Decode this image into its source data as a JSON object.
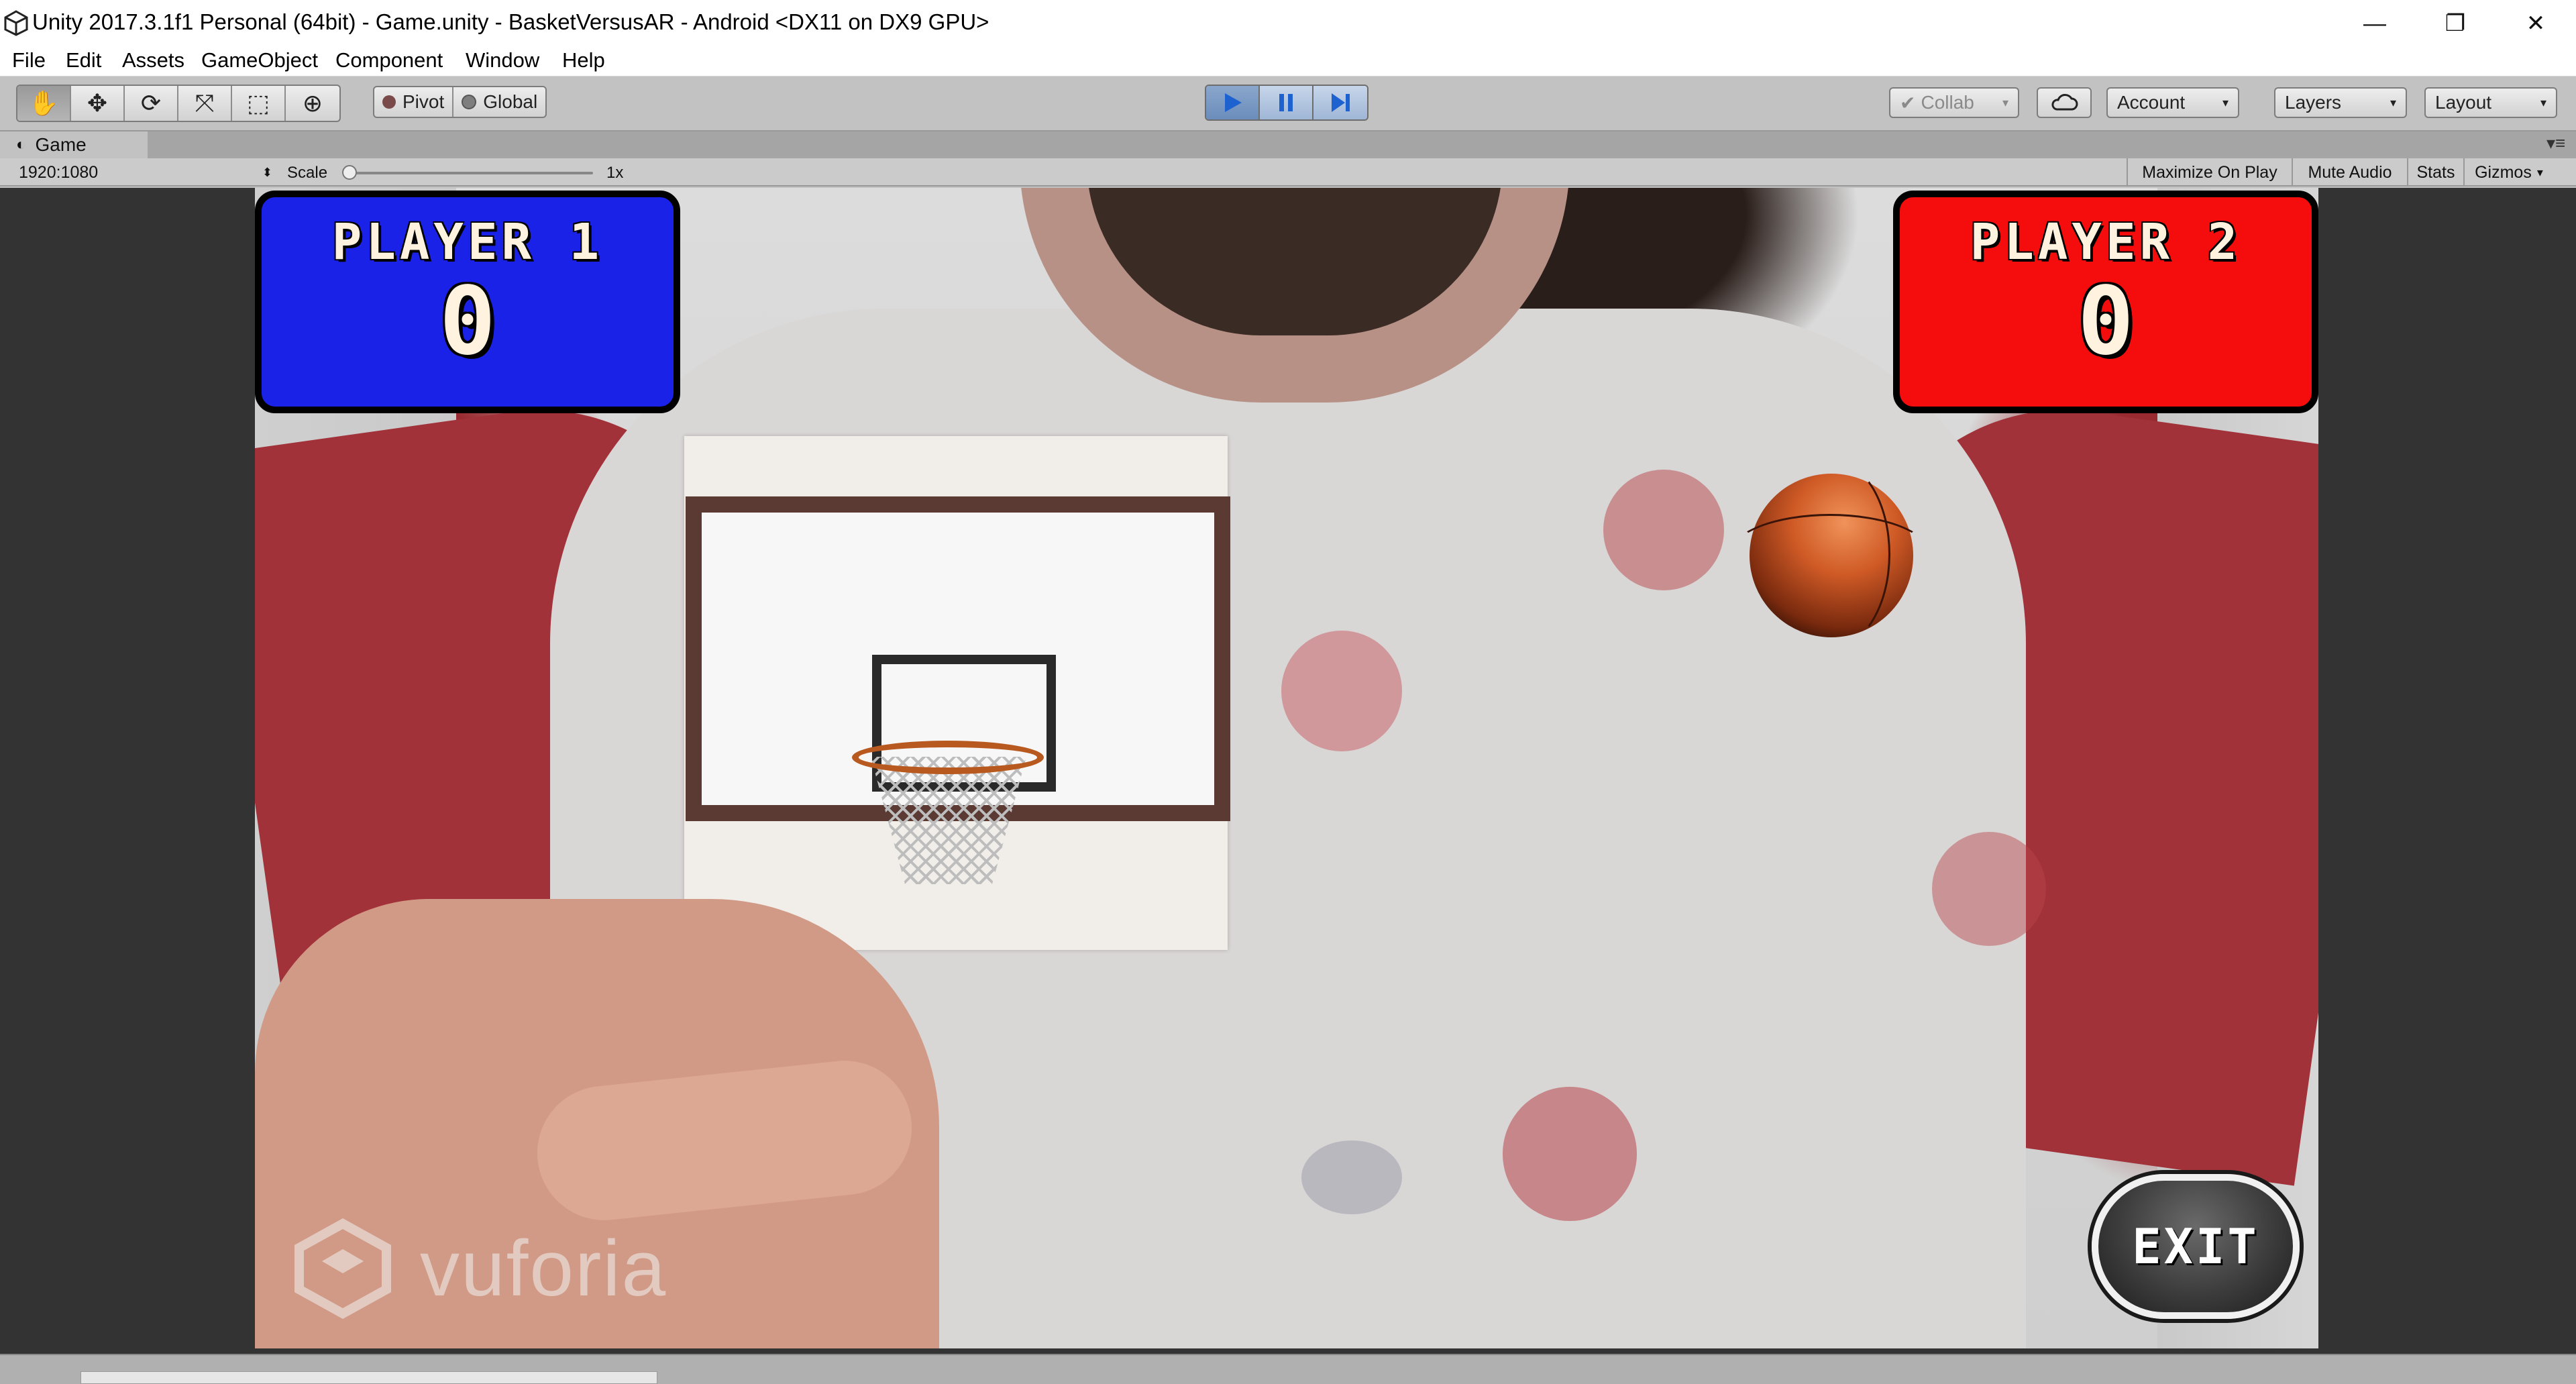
{
  "window": {
    "title": "Unity 2017.3.1f1 Personal (64bit) - Game.unity - BasketVersusAR - Android <DX11 on DX9 GPU>",
    "app_icon": "unity-icon",
    "minimize": "—",
    "maximize": "❐",
    "close": "✕"
  },
  "menu": {
    "items": [
      "File",
      "Edit",
      "Assets",
      "GameObject",
      "Component",
      "Window",
      "Help"
    ]
  },
  "toolbar": {
    "transform_tools": [
      {
        "icon": "hand-tool-icon",
        "glyph": "✋"
      },
      {
        "icon": "move-tool-icon",
        "glyph": "✥"
      },
      {
        "icon": "rotate-tool-icon",
        "glyph": "⟳"
      },
      {
        "icon": "scale-tool-icon",
        "glyph": "⤧"
      },
      {
        "icon": "rect-tool-icon",
        "glyph": "⬚"
      },
      {
        "icon": "transform-tool-icon",
        "glyph": "⊕"
      }
    ],
    "pivot_label": "Pivot",
    "global_label": "Global",
    "play": {
      "icon": "play-icon",
      "active": true
    },
    "pause": {
      "icon": "pause-icon"
    },
    "step": {
      "icon": "step-icon"
    },
    "collab_label": "Collab",
    "account_label": "Account",
    "layers_label": "Layers",
    "layout_label": "Layout",
    "play_color": "#1e62d0"
  },
  "game_view": {
    "tab_label": "Game",
    "resolution": "1920:1080",
    "scale_label": "Scale",
    "scale_value": "1x",
    "maximize_label": "Maximize On Play",
    "mute_label": "Mute Audio",
    "stats_label": "Stats",
    "gizmos_label": "Gizmos"
  },
  "game": {
    "player1": {
      "label": "PLAYER 1",
      "score": "0",
      "color": "#1a22e8"
    },
    "player2": {
      "label": "PLAYER 2",
      "score": "0",
      "color": "#f50c0c"
    },
    "exit_label": "EXIT",
    "watermark": "vuforia"
  }
}
